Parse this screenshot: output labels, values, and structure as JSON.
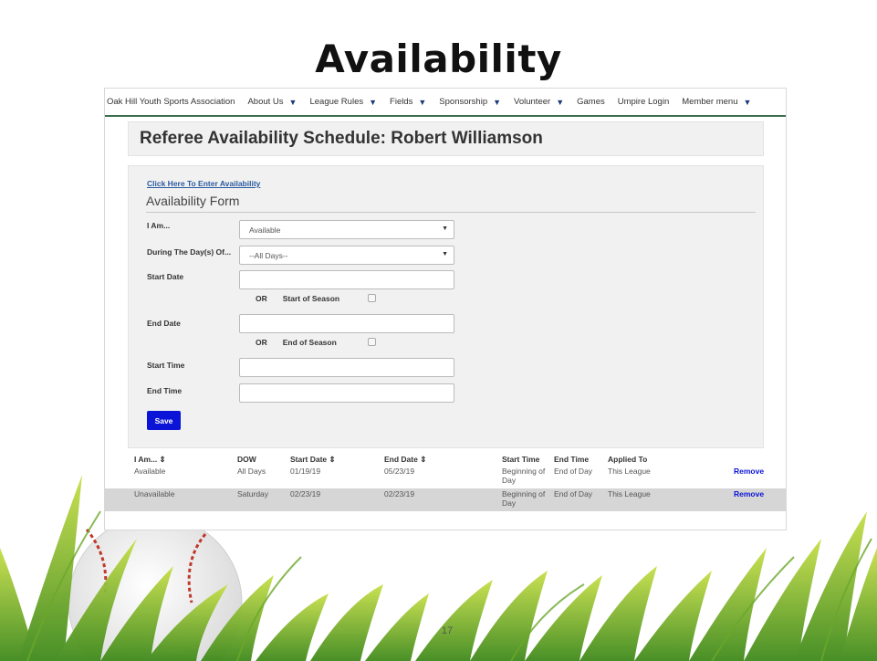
{
  "slide": {
    "title": "Availability",
    "number": "17"
  },
  "nav": {
    "items": [
      {
        "label": "Oak Hill Youth Sports Association",
        "dropdown": false
      },
      {
        "label": "About Us",
        "dropdown": true
      },
      {
        "label": "League Rules",
        "dropdown": true
      },
      {
        "label": "Fields",
        "dropdown": true
      },
      {
        "label": "Sponsorship",
        "dropdown": true
      },
      {
        "label": "Volunteer",
        "dropdown": true
      },
      {
        "label": "Games",
        "dropdown": false
      },
      {
        "label": "Umpire Login",
        "dropdown": false
      },
      {
        "label": "Member menu",
        "dropdown": true
      }
    ]
  },
  "header": {
    "title": "Referee Availability Schedule: Robert Williamson"
  },
  "form": {
    "enter_link": "Click Here To Enter Availability",
    "heading": "Availability Form",
    "i_am_label": "I Am...",
    "i_am_value": "Available",
    "days_label": "During The Day(s) Of...",
    "days_value": "--All Days--",
    "start_date_label": "Start Date",
    "start_date_value": "",
    "or_label": "OR",
    "start_of_season_label": "Start of Season",
    "end_date_label": "End Date",
    "end_date_value": "",
    "end_of_season_label": "End of Season",
    "start_time_label": "Start Time",
    "start_time_value": "",
    "end_time_label": "End Time",
    "end_time_value": "",
    "save_label": "Save"
  },
  "table": {
    "headers": [
      "I Am... ⇕",
      "DOW",
      "Start Date ⇕",
      "End Date ⇕",
      "Start Time",
      "End Time",
      "Applied To"
    ],
    "rows": [
      [
        "Available",
        "All Days",
        "01/19/19",
        "05/23/19",
        "Beginning of Day",
        "End of Day",
        "This League",
        "Remove"
      ],
      [
        "Unavailable",
        "Saturday",
        "02/23/19",
        "02/23/19",
        "Beginning of Day",
        "End of Day",
        "This League",
        "Remove"
      ]
    ]
  },
  "colors": {
    "save_button": "#0b14d6",
    "nav_border": "#3c6e4e",
    "link": "#2a5a9e"
  }
}
